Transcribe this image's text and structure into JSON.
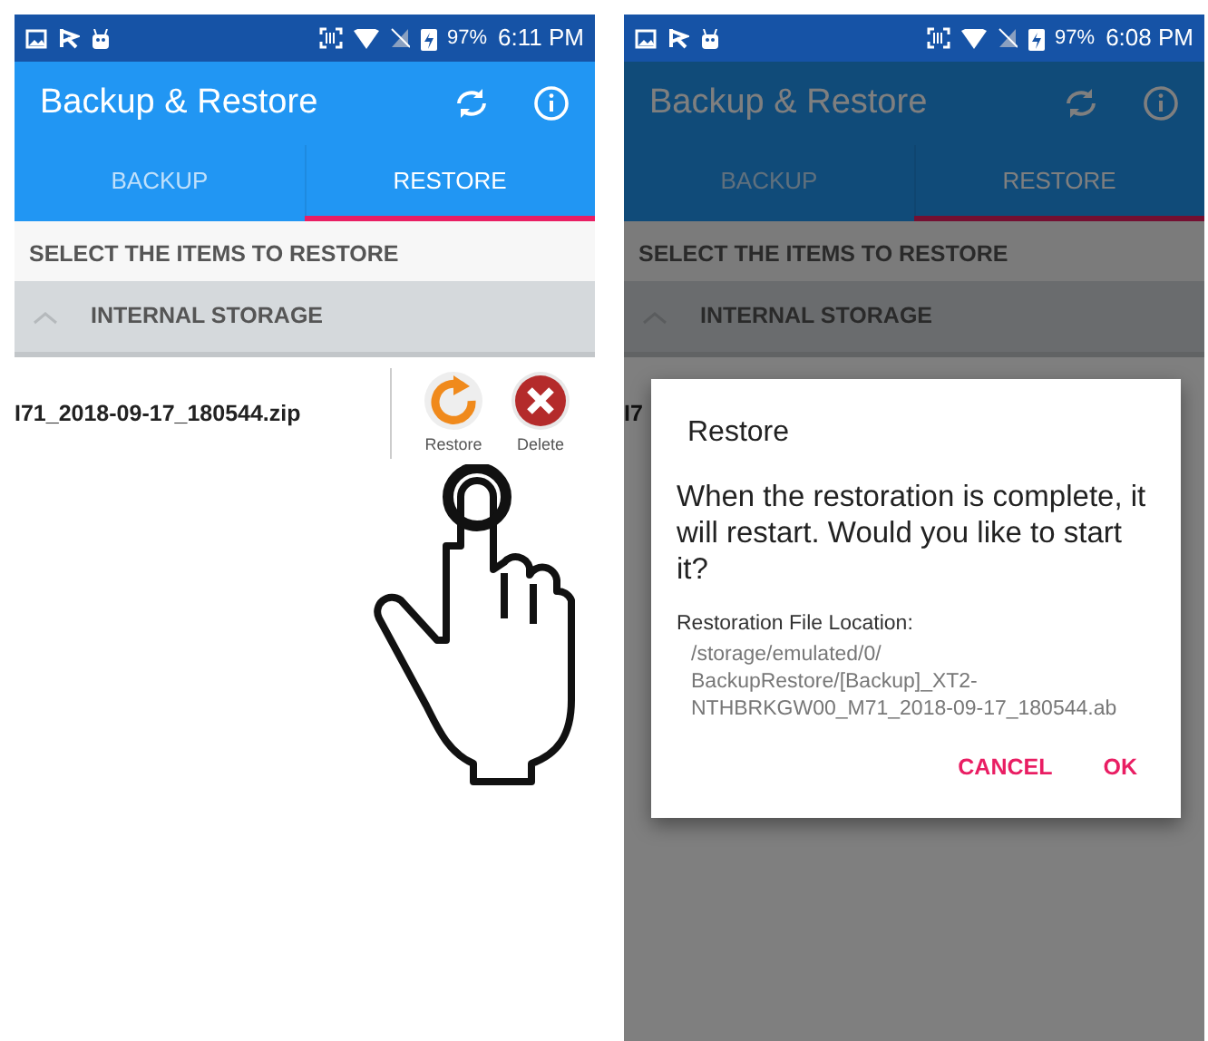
{
  "screens": [
    {
      "status_bar": {
        "battery": "97%",
        "time": "6:11 PM"
      },
      "app_bar": {
        "title": "Backup & Restore"
      },
      "tabs": [
        {
          "label": "BACKUP",
          "selected": false
        },
        {
          "label": "RESTORE",
          "selected": true
        }
      ],
      "section_header": "SELECT THE ITEMS TO RESTORE",
      "group": {
        "title": "INTERNAL STORAGE",
        "expanded": true
      },
      "file": {
        "name": "I71_2018-09-17_180544.zip",
        "actions": [
          {
            "kind": "restore",
            "label": "Restore"
          },
          {
            "kind": "delete",
            "label": "Delete"
          }
        ]
      },
      "touch_hint": true
    },
    {
      "status_bar": {
        "battery": "97%",
        "time": "6:08 PM"
      },
      "app_bar": {
        "title": "Backup & Restore"
      },
      "tabs": [
        {
          "label": "BACKUP",
          "selected": false
        },
        {
          "label": "RESTORE",
          "selected": true
        }
      ],
      "section_header": "SELECT THE ITEMS TO RESTORE",
      "group": {
        "title": "INTERNAL STORAGE",
        "expanded": true
      },
      "file": {
        "name": "I7"
      },
      "dialog": {
        "title": "Restore",
        "message": "When the restoration is complete, it will restart. Would you like to start it?",
        "location_label": "Restoration File Location:",
        "location_path": "/storage/emulated/0/\nBackupRestore/[Backup]_XT2-\nNTHBRKGW00_M71_2018-09-17_180544.ab",
        "buttons": [
          "CANCEL",
          "OK"
        ]
      }
    }
  ]
}
